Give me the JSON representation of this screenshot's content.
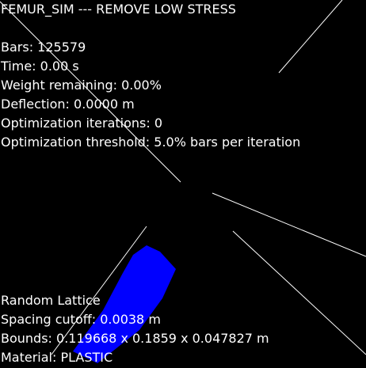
{
  "title": "FEMUR_SIM --- REMOVE LOW STRESS",
  "stats": {
    "bars": "Bars: 125579",
    "time": "Time: 0.00 s",
    "weight_remaining": "Weight remaining: 0.00%",
    "deflection": "Deflection: 0.0000 m",
    "optimization_iterations": "Optimization iterations: 0",
    "optimization_threshold": "Optimization threshold: 5.0% bars per iteration"
  },
  "lattice_info": {
    "type": "Random Lattice",
    "spacing_cutoff": "Spacing cutoff: 0.0038 m",
    "bounds": "Bounds: 0.119668 x 0.1859 x 0.047827 m",
    "material": "Material: PLASTIC"
  },
  "colors": {
    "background": "#000000",
    "text": "#ffffff",
    "bounding_lines": "#ffffff",
    "model": "#0000ff"
  }
}
